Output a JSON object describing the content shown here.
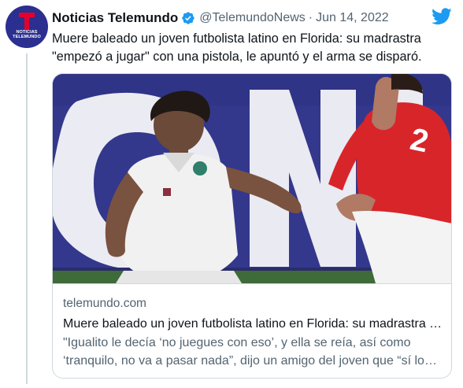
{
  "author": {
    "display_name": "Noticias Telemundo",
    "handle": "@TelemundoNews",
    "separator": "·",
    "date": "Jun 14, 2022",
    "verified": true,
    "avatar_text_line1": "NOTICIAS",
    "avatar_text_line2": "TELEMUNDO",
    "avatar_color": "#2b2f8f",
    "avatar_accent": "#e4002b"
  },
  "tweet": {
    "text": "Muere baleado un joven futbolista latino en Florida: su madrastra \"empezó a jugar\" con una pistola, le apuntó y el arma se disparó."
  },
  "card": {
    "domain": "telemundo.com",
    "title": "Muere baleado un joven futbolista latino en Florida: su madrastra muere...",
    "description": "\"Igualito le decía ‘no juegues con eso’, y ella se reía, así como ‘tranquilo, no va a pasar nada”, dijo un amigo del joven que “sí lo había hecho antes”.",
    "image_alt": "Young soccer players in white and red uniforms on a field",
    "banner_text": "ONE"
  },
  "icons": {
    "brand": "twitter-bird-icon",
    "verified": "verified-badge-icon"
  },
  "colors": {
    "twitter_blue": "#1d9bf0",
    "text_primary": "#0f1419",
    "text_secondary": "#536471",
    "border": "#cfd9de"
  }
}
